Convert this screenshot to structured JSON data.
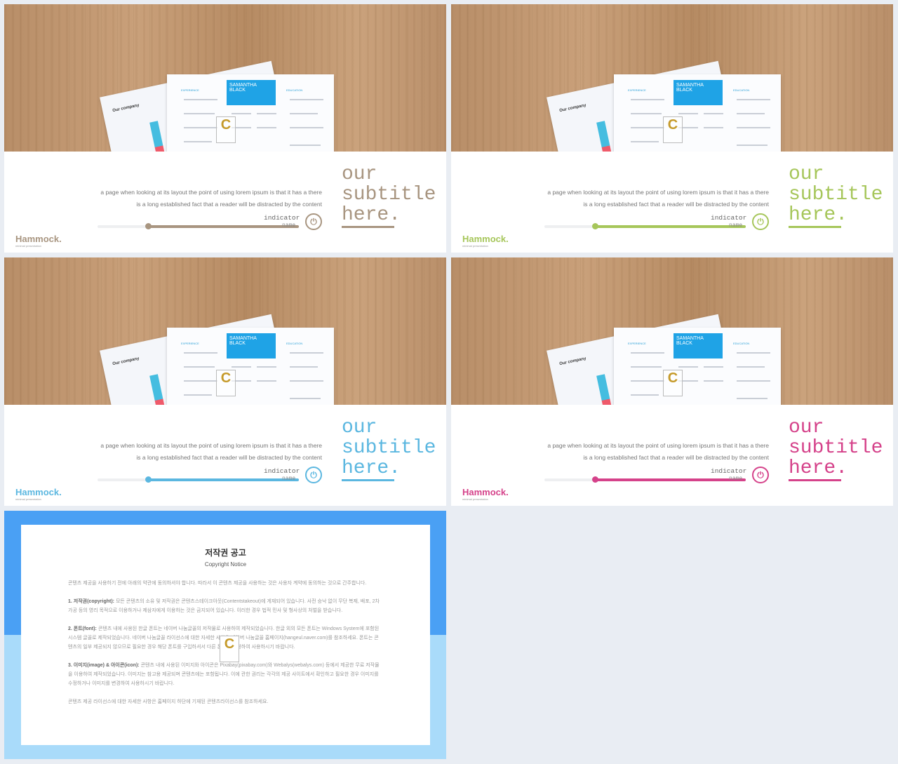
{
  "slides": [
    {
      "accent": "#a89580",
      "title": "our\nsubtitle\nhere.",
      "paragraph": [
        "a page when looking at its layout the point of using lorem ipsum is that it has a there",
        "is a long established fact that a reader will be distracted by the content"
      ],
      "indicator": "indicator",
      "indicator_name": "name",
      "progress": 0.25,
      "logo": "Hammock.",
      "logo_sub": "minimal presentation"
    },
    {
      "accent": "#a6c65a",
      "title": "our\nsubtitle\nhere.",
      "paragraph": [
        "a page when looking at its layout the point of using lorem ipsum is that it has a there",
        "is a long established fact that a reader will be distracted by the content"
      ],
      "indicator": "indicator",
      "indicator_name": "name",
      "progress": 0.25,
      "logo": "Hammock.",
      "logo_sub": "minimal presentation"
    },
    {
      "accent": "#5bb7e0",
      "title": "our\nsubtitle\nhere.",
      "paragraph": [
        "a page when looking at its layout the point of using lorem ipsum is that it has a there",
        "is a long established fact that a reader will be distracted by the content"
      ],
      "indicator": "indicator",
      "indicator_name": "name",
      "progress": 0.25,
      "logo": "Hammock.",
      "logo_sub": "minimal presentation"
    },
    {
      "accent": "#d5428a",
      "title": "our\nsubtitle\nhere.",
      "paragraph": [
        "a page when looking at its layout the point of using lorem ipsum is that it has a there",
        "is a long established fact that a reader will be distracted by the content"
      ],
      "indicator": "indicator",
      "indicator_name": "name",
      "progress": 0.25,
      "logo": "Hammock.",
      "logo_sub": "minimal presentation"
    }
  ],
  "photo": {
    "chart_title": "Our company",
    "resume_name": "SAMANTHA BLACK",
    "experience": "EXPERIENCE",
    "education": "EDUCATION",
    "watermark": "C"
  },
  "copyright": {
    "title": "저작권 공고",
    "subtitle": "Copyright Notice",
    "intro": "콘텐츠 제공을 사용하기 전에 아래의 약관에 동의하셔야 합니다. 따라서 이 콘텐츠 제공을 사용하는 것은 사용자 계약에 동의하는 것으로 간주합니다.",
    "s1_label": "1. 저작권(copyright):",
    "s1_text": "모든 콘텐츠의 소유 및 저작권은 콘텐츠스테이크아웃(Contentstakeout)에 게재되어 있습니다. 사전 승낙 없이 무단 복제, 배포, 2차 가공 등의 영리 목적으로 이용하거나 제삼자에게 이용하는 것은 금지되어 있습니다. 이러한 경우 법적 민사 및 형사상의 처벌을 받습니다.",
    "s2_label": "2. 폰트(font):",
    "s2_text": "콘텐츠 내에 사용된 한글 폰트는 네이버 나눔글꼴의 저작물로 사용하여 제작되었습니다. 한글 외의 모든 폰트는 Windows System에 포함된 시스템 글꼴로 제작되었습니다. 네이버 나눔글꼴 라이선스에 대한 자세한 사항은 네이버 나눔글꼴 홈페이지(hangeul.naver.com)를 참조하세요. 폰트는 콘텐츠의 일부 제공되지 않으므로 필요한 경우 해당 폰트를 구입하셔서 다른 폰트로 변경하여 사용하시기 바랍니다.",
    "s3_label": "3. 이미지(image) & 아이콘(icon):",
    "s3_text": "콘텐츠 내에 사용된 이미지와 아이콘은 Pixabay(pixabay.com)와 Webalys(webalys.com) 등에서 제공한 무료 저작물을 이용하여 제작되었습니다. 이미지는 참고용 제공되며 콘텐츠에는 포함됩니다. 이에 관한 권리는 각각의 제공 사이트에서 확인하고 필요한 경우 이미지를 수정하거나 이미지를 변경하여 사용하시기 바랍니다.",
    "footer": "콘텐츠 제공 라이선스에 대한 자세한 사항은 홈페이지 하단에 기재된 콘텐츠라이선스를 참조하세요."
  }
}
